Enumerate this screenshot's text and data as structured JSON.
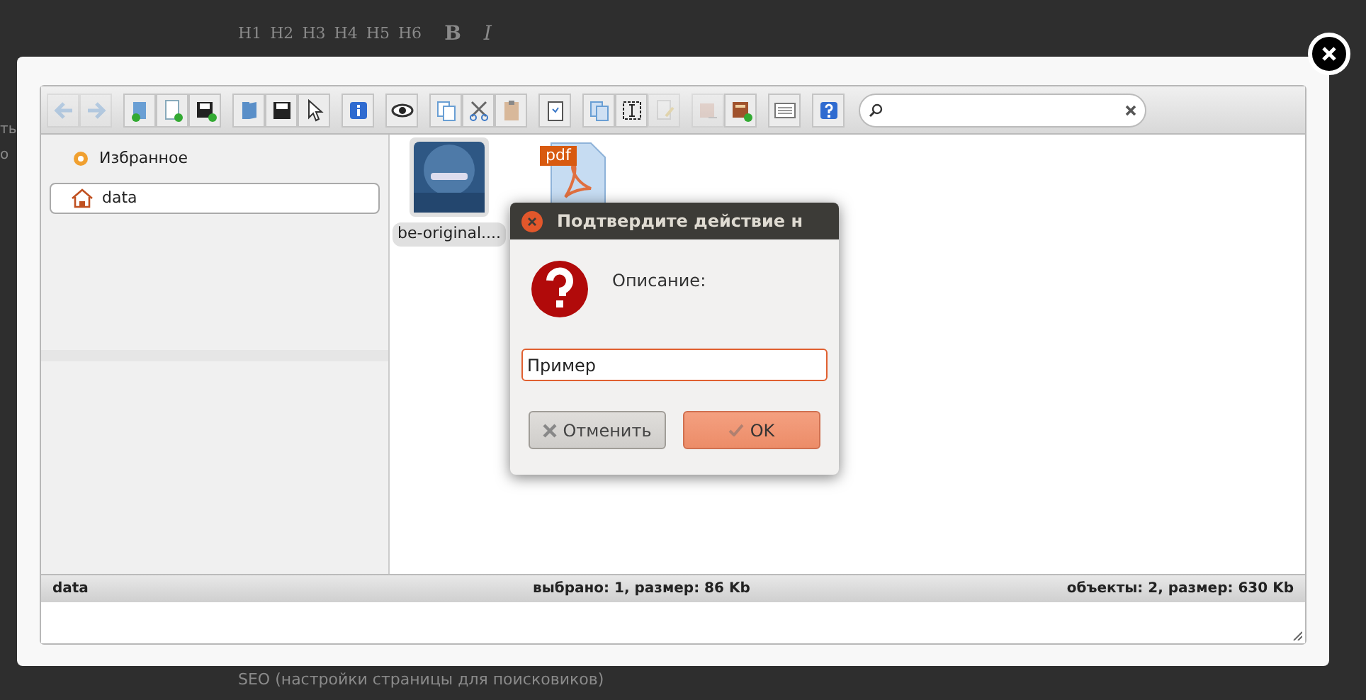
{
  "background_page": {
    "format_buttons": [
      "H1",
      "H2",
      "H3",
      "H4",
      "H5",
      "H6",
      "B",
      "I"
    ],
    "left_fragments": [
      "ть",
      "о"
    ],
    "bottom_text": "SEO (настройки страницы для поисковиков)"
  },
  "file_manager": {
    "toolbar_groups": [
      [
        {
          "disabled": true
        },
        {
          "disabled": true
        }
      ],
      [
        {
          "disabled": false
        },
        {
          "disabled": false
        },
        {
          "disabled": false
        }
      ],
      [
        {
          "disabled": false
        },
        {
          "disabled": false
        },
        {
          "disabled": false
        }
      ],
      [
        {
          "disabled": false
        }
      ],
      [
        {
          "disabled": false
        }
      ],
      [
        {
          "disabled": false
        },
        {
          "disabled": false
        },
        {
          "disabled": false
        }
      ],
      [
        {
          "disabled": false
        }
      ],
      [
        {
          "disabled": false
        },
        {
          "disabled": false
        },
        {
          "disabled": true
        }
      ],
      [
        {
          "disabled": true
        },
        {
          "disabled": false
        }
      ],
      [
        {
          "disabled": false
        }
      ],
      [
        {
          "disabled": false
        }
      ]
    ],
    "places": [
      {
        "label": "Избранное",
        "kind": "favorites",
        "selected": false
      },
      {
        "label": "data",
        "kind": "folder",
        "selected": true
      }
    ],
    "files": [
      {
        "name": "be-original....",
        "selected": true
      },
      {
        "kind": "pdf",
        "badge": "pdf",
        "selected": false
      }
    ],
    "status_bar": {
      "path": "data",
      "selection": "выбрано: 1, размер: 86 Kb",
      "totals": "объекты: 2, размер: 630 Kb"
    }
  },
  "dialog": {
    "title": "Подтвердите действие н",
    "label": "Описание:",
    "value": "Пример",
    "buttons": [
      {
        "label": "Отменить",
        "kind": "cancel"
      },
      {
        "label": "OK",
        "kind": "ok"
      }
    ]
  }
}
